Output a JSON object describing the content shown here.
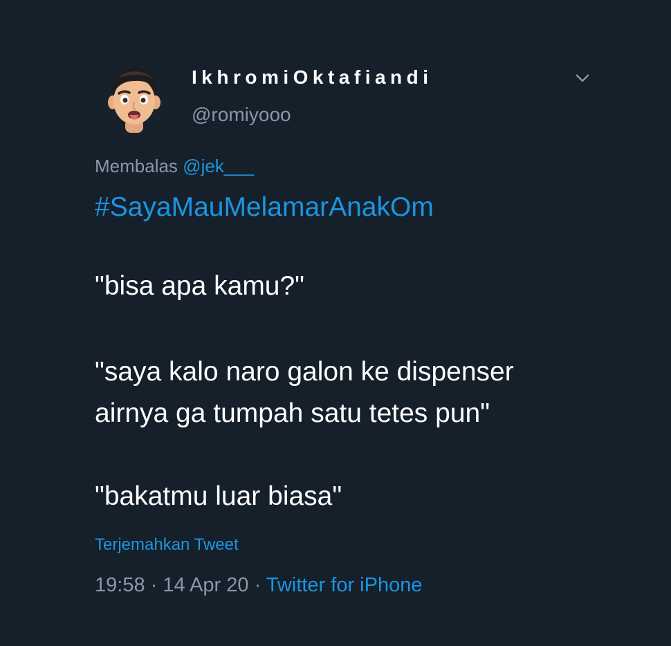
{
  "tweet": {
    "display_name": "IkhromiOktafiandi",
    "handle": "@romiyooo",
    "reply_prefix": "Membalas",
    "reply_to": "@jek___",
    "hashtag": "#SayaMauMelamarAnakOm",
    "lines": [
      "\"bisa apa kamu?\"",
      "\"saya kalo naro galon ke dispenser",
      "airnya ga tumpah satu tetes pun\"",
      "\"bakatmu luar biasa\""
    ],
    "translate_label": "Terjemahkan Tweet",
    "time": "19:58",
    "separator": "·",
    "date": "14 Apr 20",
    "source": "Twitter for iPhone"
  },
  "icons": {
    "avatar": "memoji-avatar",
    "menu": "chevron-down-icon"
  },
  "colors": {
    "background": "#15202b",
    "primary_text": "#ffffff",
    "secondary_text": "#8899a6",
    "link": "#1b95e0"
  }
}
